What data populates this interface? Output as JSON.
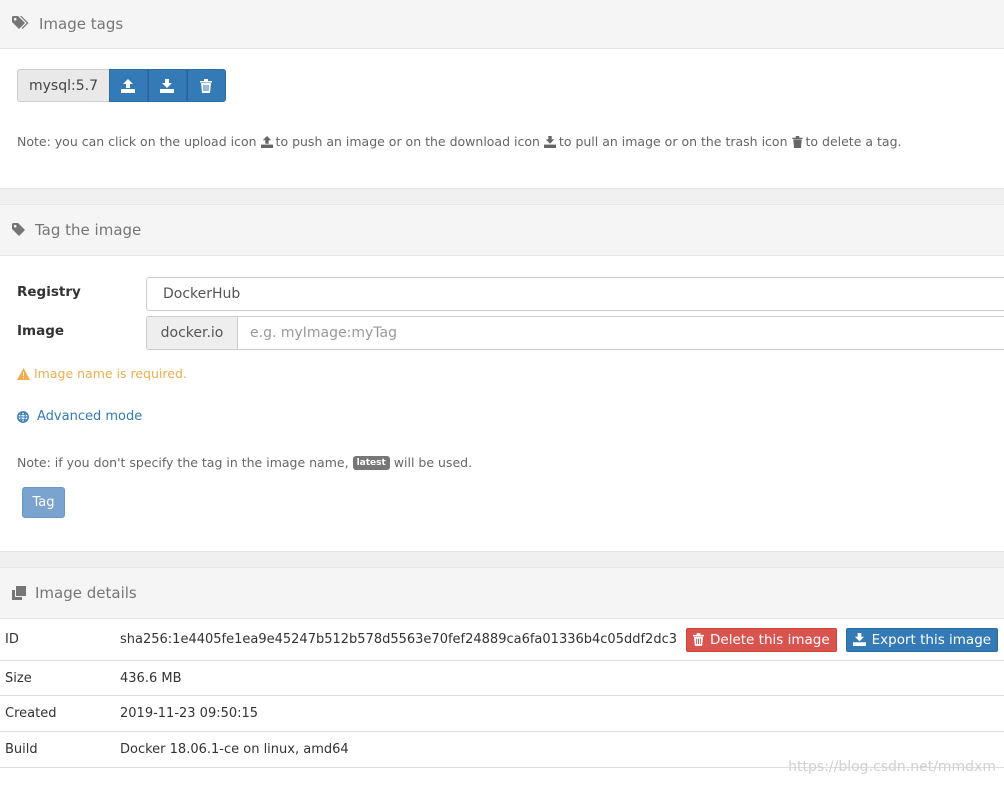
{
  "image_tags": {
    "title": "Image tags",
    "tag_name": "mysql:5.7",
    "note_parts": [
      "Note: you can click on the upload icon",
      "to push an image or on the download icon",
      "to pull an image or on the trash icon",
      "to delete a tag."
    ]
  },
  "tag_image": {
    "title": "Tag the image",
    "registry_label": "Registry",
    "registry_value": "DockerHub",
    "image_label": "Image",
    "image_prefix": "docker.io",
    "image_placeholder": "e.g. myImage:myTag",
    "warning": "Image name is required.",
    "advanced_mode": "Advanced mode",
    "note_before": "Note: if you don't specify the tag in the image name,",
    "note_badge": "latest",
    "note_after": "will be used.",
    "submit": "Tag"
  },
  "image_details": {
    "title": "Image details",
    "rows": [
      {
        "label": "ID",
        "value": "sha256:1e4405fe1ea9e45247b512b578d5563e70fef24889ca6fa01336b4c05ddf2dc3"
      },
      {
        "label": "Size",
        "value": "436.6 MB"
      },
      {
        "label": "Created",
        "value": "2019-11-23 09:50:15"
      },
      {
        "label": "Build",
        "value": "Docker 18.06.1-ce on linux, amd64"
      }
    ],
    "delete_button": "Delete this image",
    "export_button": "Export this image"
  },
  "watermark": "https://blog.csdn.net/mmdxm",
  "colors": {
    "primary": "#337ab7",
    "danger": "#d9534f",
    "warning": "#f0ad4e"
  }
}
